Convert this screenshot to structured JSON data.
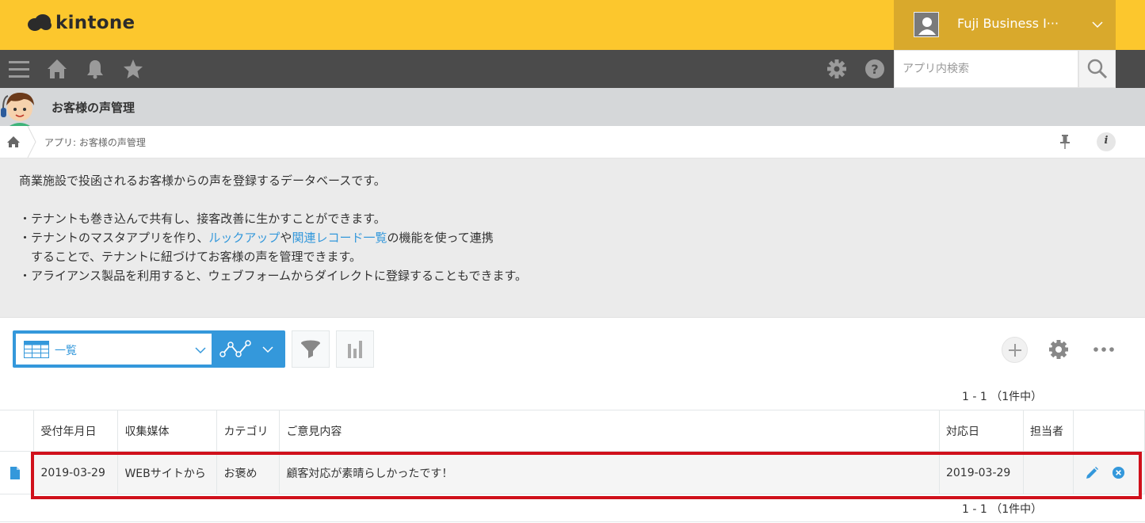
{
  "header": {
    "logo_text": "kintone",
    "user_name": "Fuji Business I···"
  },
  "nav": {
    "search_placeholder": "アプリ内検索"
  },
  "app": {
    "title": "お客様の声管理"
  },
  "breadcrumb": {
    "text": "アプリ: お客様の声管理"
  },
  "description": {
    "line1": "商業施設で投函されるお客様からの声を登録するデータベースです。",
    "line2": "・テナントも巻き込んで共有し、接客改善に生かすことができます。",
    "line3_prefix": "・テナントのマスタアプリを作り、",
    "line3_link1": "ルックアップ",
    "line3_mid": "や",
    "line3_link2": "関連レコード一覧",
    "line3_suffix": "の機能を使って連携",
    "line4": "　することで、テナントに紐づけてお客様の声を管理できます。",
    "line5": "・アライアンス製品を利用すると、ウェブフォームからダイレクトに登録することもできます。",
    "link_color": "#3498db"
  },
  "toolbar": {
    "view_label": "一覧",
    "accent_color": "#3498db"
  },
  "pager": {
    "top": "1 - 1 （1件中）",
    "bottom": "1 - 1 （1件中）"
  },
  "table": {
    "columns": [
      "受付年月日",
      "収集媒体",
      "カテゴリ",
      "ご意見内容",
      "対応日",
      "担当者"
    ],
    "rows": [
      {
        "cells": [
          "2019-03-29",
          "WEBサイトから",
          "お褒め",
          "顧客対応が素晴らしかったです！",
          "2019-03-29",
          ""
        ]
      }
    ],
    "highlight_color": "#d0101b"
  },
  "colors": {
    "header_bg": "#fcc72d",
    "nav_bg": "#4b4b4b"
  }
}
